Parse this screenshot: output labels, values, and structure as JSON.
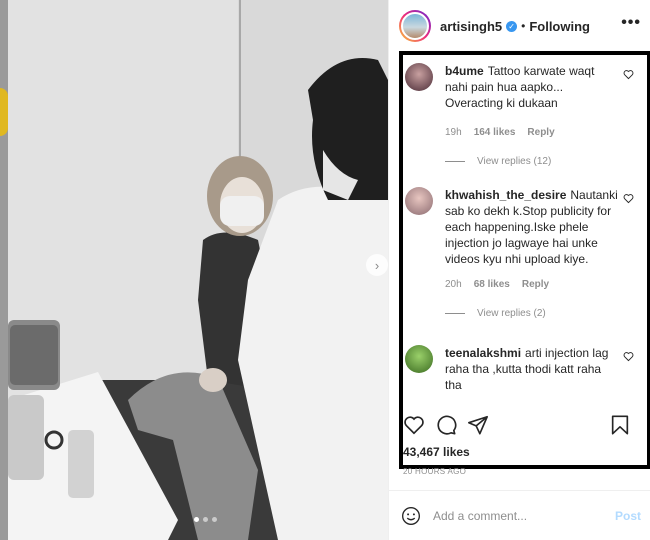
{
  "post": {
    "username": "artisingh5",
    "separator": "•",
    "follow_status": "Following",
    "more_label": "•••",
    "next_label": "›"
  },
  "comments": [
    {
      "username": "b4ume",
      "text": "Tattoo karwate waqt nahi pain hua aapko... Overacting ki dukaan",
      "time": "19h",
      "likes": "164 likes",
      "reply": "Reply",
      "view_replies": "View replies (12)"
    },
    {
      "username": "khwahish_the_desire",
      "text": "Nautanki sab ko dekh k.Stop publicity for each happening.Iske phele injection jo lagwaye hai unke videos kyu nhi upload kiye.",
      "time": "20h",
      "likes": "68 likes",
      "reply": "Reply",
      "view_replies": "View replies (2)"
    },
    {
      "username": "teenalakshmi",
      "text": "arti injection lag raha tha ,kutta thodi katt raha tha"
    }
  ],
  "stats": {
    "likes": "43,467 likes",
    "time_ago": "20 HOURS AGO"
  },
  "composer": {
    "placeholder": "Add a comment...",
    "post_label": "Post"
  },
  "carousel": {
    "count": 3,
    "active": 0
  },
  "colors": {
    "verified": "#3897f0",
    "post_disabled": "#b3dbff",
    "frame": "#000000"
  },
  "icons": [
    "heart-icon",
    "comment-icon",
    "share-icon",
    "bookmark-icon",
    "emoji-icon",
    "verified-icon",
    "more-icon",
    "chevron-right-icon"
  ]
}
